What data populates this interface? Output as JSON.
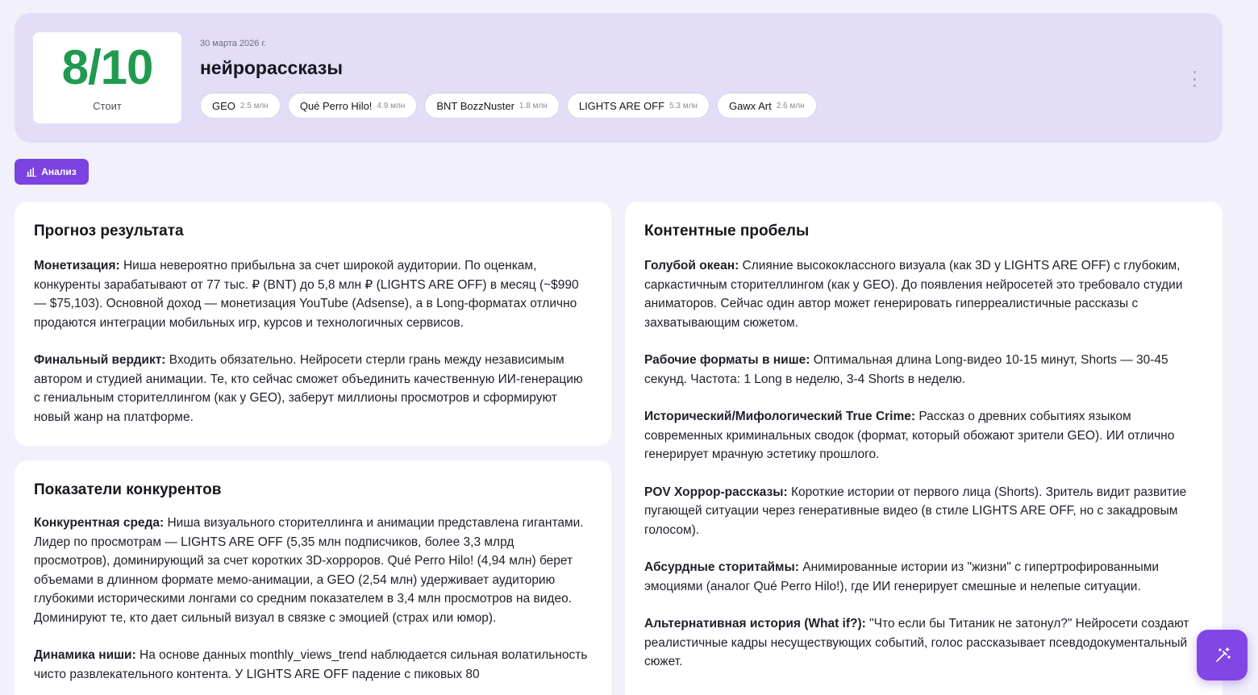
{
  "header": {
    "score": "8/10",
    "score_label": "Стоит",
    "date": "30 марта 2026 г.",
    "title": "нейрорассказы",
    "channels": [
      {
        "name": "GEO",
        "subs": "2.5 млн"
      },
      {
        "name": "Qué Perro Hilo!",
        "subs": "4.9 млн"
      },
      {
        "name": "BNT BozzNuster",
        "subs": "1.8 млн"
      },
      {
        "name": "LIGHTS ARE OFF",
        "subs": "5.3 млн"
      },
      {
        "name": "Gawx Art",
        "subs": "2.6 млн"
      }
    ]
  },
  "toolbar": {
    "analysis_label": "Анализ"
  },
  "forecast": {
    "title": "Прогноз результата",
    "paragraphs": [
      {
        "label": "Монетизация:",
        "text": " Ниша невероятно прибыльна за счет широкой аудитории. По оценкам, конкуренты зарабатывают от 77 тыс. ₽ (BNT) до 5,8 млн ₽ (LIGHTS ARE OFF) в месяц (~$990 — $75,103). Основной доход — монетизация YouTube (Adsense), а в Long-форматах отлично продаются интеграции мобильных игр, курсов и технологичных сервисов."
      },
      {
        "label": "Финальный вердикт:",
        "text": " Входить обязательно. Нейросети стерли грань между независимым автором и студией анимации. Те, кто сейчас сможет объединить качественную ИИ-генерацию с гениальным сторителлингом (как у GEO), заберут миллионы просмотров и сформируют новый жанр на платформе."
      }
    ]
  },
  "competitors": {
    "title": "Показатели конкурентов",
    "paragraphs": [
      {
        "label": "Конкурентная среда:",
        "text": " Ниша визуального сторителлинга и анимации представлена гигантами. Лидер по просмотрам — LIGHTS ARE OFF (5,35 млн подписчиков, более 3,3 млрд просмотров), доминирующий за счет коротких 3D-хорроров. Qué Perro Hilo! (4,94 млн) берет объемами в длинном формате мемо-анимации, а GEO (2,54 млн) удерживает аудиторию глубокими историческими лонгами со средним показателем в 3,4 млн просмотров на видео. Доминируют те, кто дает сильный визуал в связке с эмоцией (страх или юмор)."
      },
      {
        "label": "Динамика ниши:",
        "text": " На основе данных monthly_views_trend наблюдается сильная волатильность чисто развлекательного контента. У LIGHTS ARE OFF падение с пиковых 80"
      }
    ]
  },
  "gaps": {
    "title": "Контентные пробелы",
    "paragraphs": [
      {
        "label": "Голубой океан:",
        "text": " Слияние высококлассного визуала (как 3D у LIGHTS ARE OFF) с глубоким, саркастичным сторителлингом (как у GEO). До появления нейросетей это требовало студии аниматоров. Сейчас один автор может генерировать гиперреалистичные рассказы с захватывающим сюжетом."
      },
      {
        "label": "Рабочие форматы в нише:",
        "text": " Оптимальная длина Long-видео 10-15 минут, Shorts — 30-45 секунд. Частота: 1 Long в неделю, 3-4 Shorts в неделю."
      },
      {
        "label": "Исторический/Мифологический True Crime:",
        "text": " Рассказ о древних событиях языком современных криминальных сводок (формат, который обожают зрители GEO). ИИ отлично генерирует мрачную эстетику прошлого."
      },
      {
        "label": "POV Хоррор-рассказы:",
        "text": " Короткие истории от первого лица (Shorts). Зритель видит развитие пугающей ситуации через генеративные видео (в стиле LIGHTS ARE OFF, но с закадровым голосом)."
      },
      {
        "label": "Абсурдные сторитаймы:",
        "text": " Анимированные истории из \"жизни\" с гипертрофированными эмоциями (аналог Qué Perro Hilo!), где ИИ генерирует смешные и нелепые ситуации."
      },
      {
        "label": "Альтернативная история (What if?):",
        "text": " \"Что если бы Титаник не затонул?\" Нейросети создают реалистичные кадры несуществующих событий, голос рассказывает псевдодокументальный сюжет."
      }
    ]
  },
  "icons": {
    "analysis": "bar-chart-icon",
    "fab": "magic-wand-icon",
    "menu": "kebab-menu-icon"
  },
  "colors": {
    "accent": "#7c43e2",
    "score": "#1f9a4f",
    "header_bg": "#e3ddf7"
  }
}
